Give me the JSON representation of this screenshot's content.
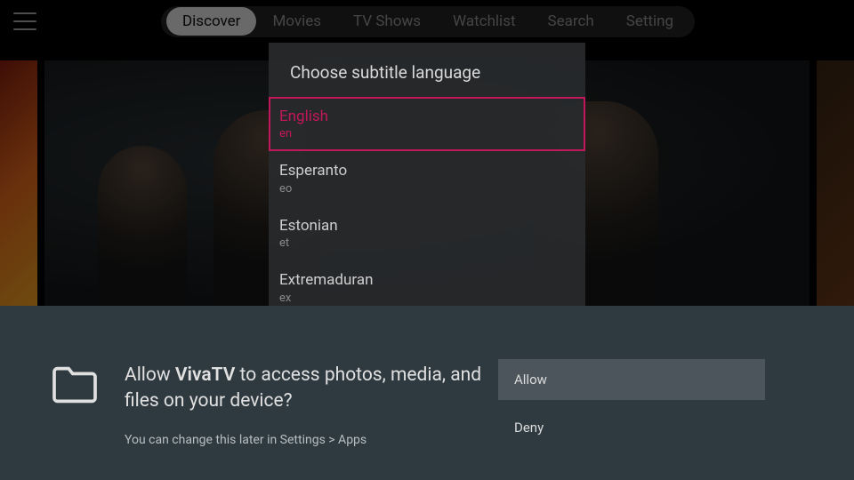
{
  "nav": {
    "tabs": [
      "Discover",
      "Movies",
      "TV Shows",
      "Watchlist",
      "Search",
      "Setting"
    ],
    "active_index": 0
  },
  "subtitle_dialog": {
    "title": "Choose subtitle language",
    "selected_index": 0,
    "languages": [
      {
        "name": "English",
        "code": "en"
      },
      {
        "name": "Esperanto",
        "code": "eo"
      },
      {
        "name": "Estonian",
        "code": "et"
      },
      {
        "name": "Extremaduran",
        "code": "ex"
      }
    ]
  },
  "permission": {
    "prefix": "Allow ",
    "app_name": "VivaTV",
    "suffix": " to access photos, media, and files on your device?",
    "sub_text": "You can change this later in Settings > Apps",
    "allow_label": "Allow",
    "deny_label": "Deny"
  }
}
